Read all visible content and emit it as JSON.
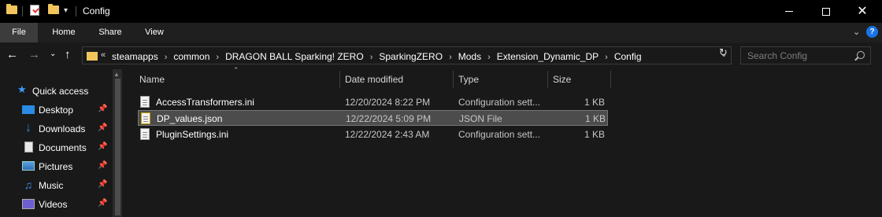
{
  "window": {
    "title": "Config"
  },
  "ribbon": {
    "tabs": [
      "File",
      "Home",
      "Share",
      "View"
    ]
  },
  "address": {
    "overflow": "«",
    "crumbs": [
      "steamapps",
      "common",
      "DRAGON BALL Sparking! ZERO",
      "SparkingZERO",
      "Mods",
      "Extension_Dynamic_DP",
      "Config"
    ]
  },
  "search": {
    "placeholder": "Search Config"
  },
  "sidebar": {
    "quick_access": "Quick access",
    "items": [
      {
        "label": "Desktop",
        "icon": "desktop-icon",
        "pinned": true
      },
      {
        "label": "Downloads",
        "icon": "download-icon",
        "pinned": true
      },
      {
        "label": "Documents",
        "icon": "documents-icon",
        "pinned": true
      },
      {
        "label": "Pictures",
        "icon": "pictures-icon",
        "pinned": true
      },
      {
        "label": "Music",
        "icon": "music-icon",
        "pinned": true
      },
      {
        "label": "Videos",
        "icon": "videos-icon",
        "pinned": true
      }
    ]
  },
  "columns": {
    "name": "Name",
    "date": "Date modified",
    "type": "Type",
    "size": "Size"
  },
  "files": [
    {
      "name": "AccessTransformers.ini",
      "date": "12/20/2024 8:22 PM",
      "type": "Configuration sett...",
      "size": "1 KB",
      "selected": false
    },
    {
      "name": "DP_values.json",
      "date": "12/22/2024 5:09 PM",
      "type": "JSON File",
      "size": "1 KB",
      "selected": true
    },
    {
      "name": "PluginSettings.ini",
      "date": "12/22/2024 2:43 AM",
      "type": "Configuration sett...",
      "size": "1 KB",
      "selected": false
    }
  ]
}
